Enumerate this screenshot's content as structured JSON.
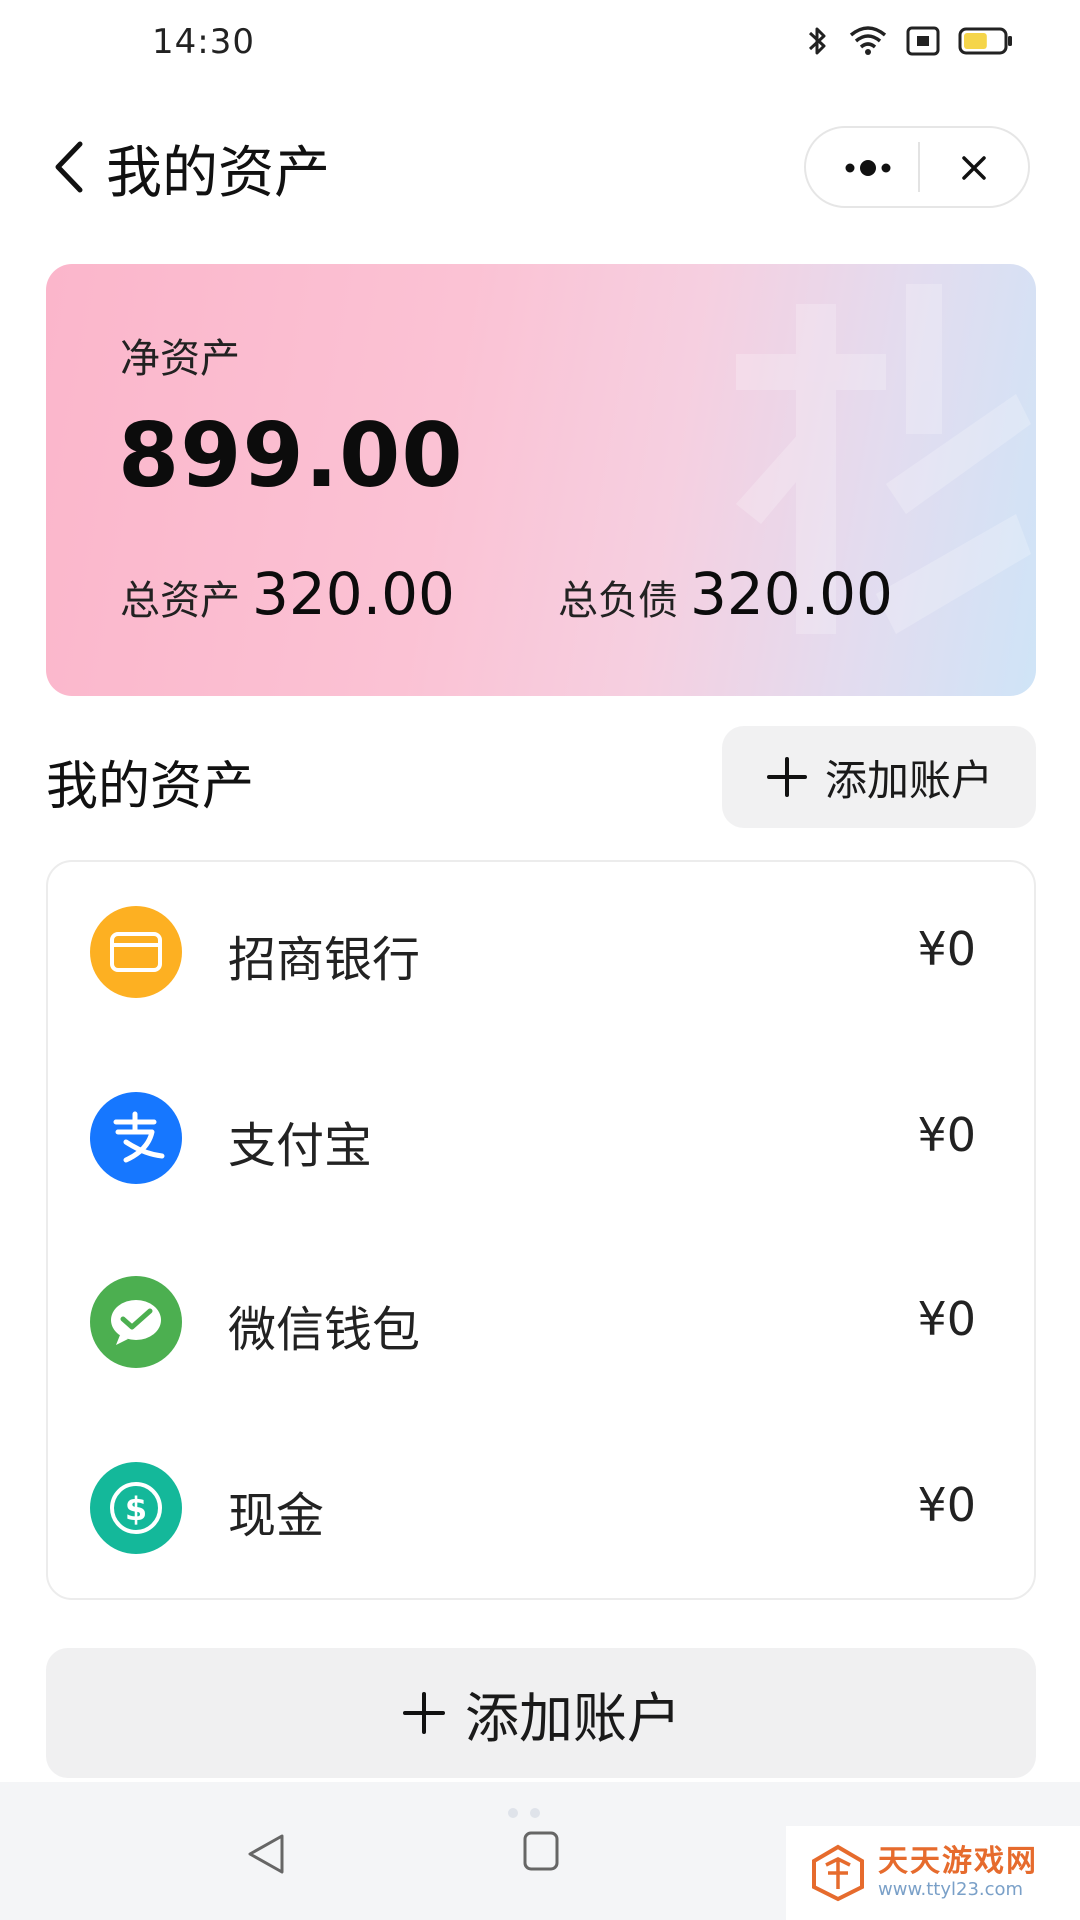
{
  "status_bar": {
    "time": "14:30",
    "battery_level_pct": 60
  },
  "header": {
    "title": "我的资产"
  },
  "asset_card": {
    "net_label": "净资产",
    "net_value": "899.00",
    "total_assets_label": "总资产",
    "total_assets_value": "320.00",
    "total_debt_label": "总负债",
    "total_debt_value": "320.00"
  },
  "section": {
    "title": "我的资产",
    "add_button_label": "添加账户"
  },
  "accounts": [
    {
      "name": "招商银行",
      "amount": "¥0",
      "icon": "wallet-icon",
      "color": "#FDB022"
    },
    {
      "name": "支付宝",
      "amount": "¥0",
      "icon": "alipay-icon",
      "color": "#1677FF"
    },
    {
      "name": "微信钱包",
      "amount": "¥0",
      "icon": "wechat-pay-icon",
      "color": "#4CAF50"
    },
    {
      "name": "现金",
      "amount": "¥0",
      "icon": "cash-icon",
      "color": "#14B89A"
    }
  ],
  "add_account_button": {
    "label": "添加账户"
  },
  "watermark": {
    "title": "天天游戏网",
    "url": "www.ttyl23.com"
  }
}
